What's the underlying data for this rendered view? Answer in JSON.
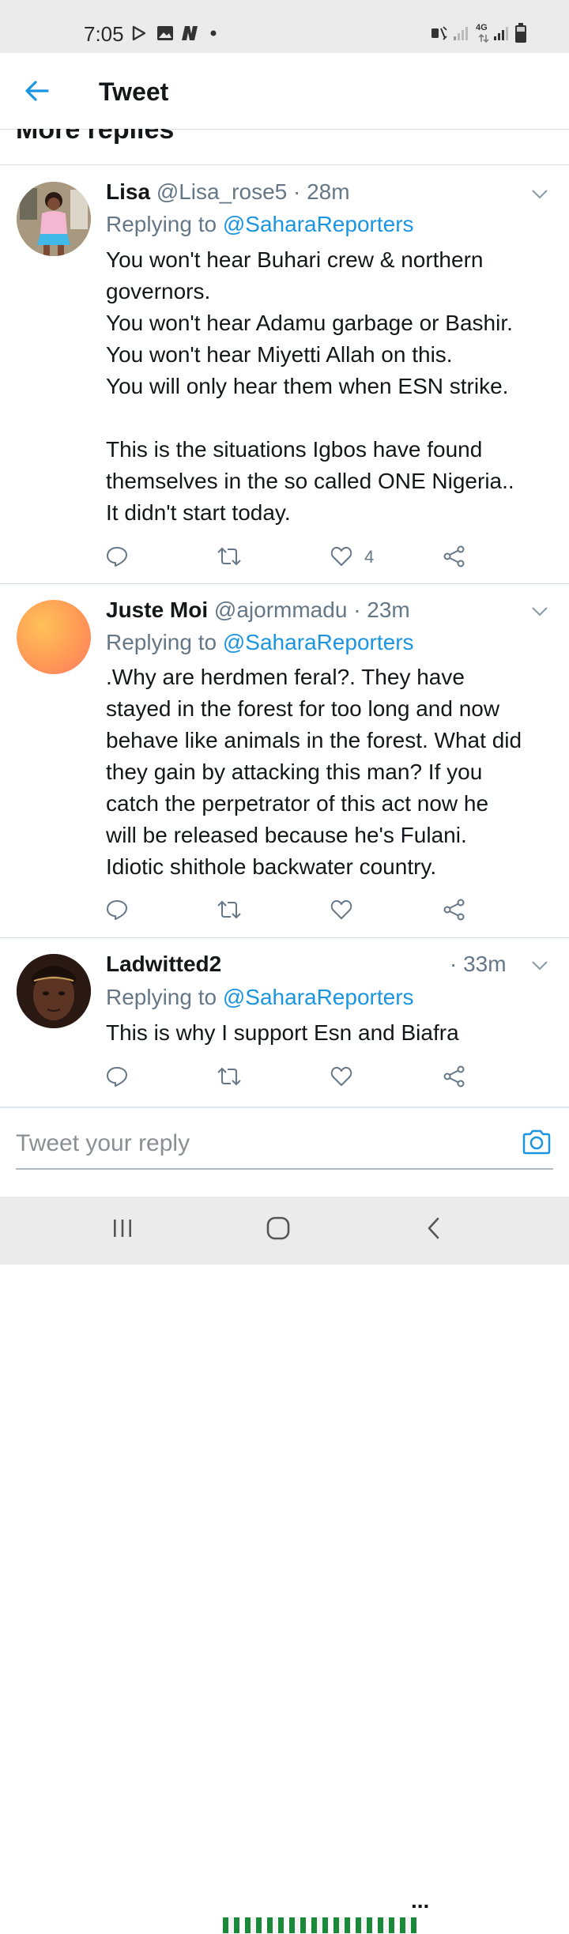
{
  "status_bar": {
    "time": "7:05",
    "icons_left": [
      "play-store-icon",
      "gallery-icon",
      "news-icon",
      "dot-icon"
    ],
    "icons_right": [
      "mute-icon",
      "signal-weak-icon",
      "4g-icon",
      "signal-icon",
      "battery-icon"
    ],
    "network": "4G"
  },
  "app_bar": {
    "title": "Tweet",
    "back_icon": "back-arrow-icon"
  },
  "section": {
    "title": "More replies"
  },
  "tweets": [
    {
      "name": "Lisa",
      "handle": "@Lisa_rose5",
      "time": "· 28m",
      "replying_prefix": "Replying to ",
      "replying_to": "@SaharaReporters",
      "text": "You won't hear Buhari crew & northern\ngovernors.\nYou won't hear Adamu garbage or Bashir.\nYou won't hear Miyetti Allah on this.\nYou will only hear them when ESN strike.\n\nThis is the situations Igbos have found\nthemselves in the so called ONE Nigeria..\nIt didn't start today.",
      "likes": "4"
    },
    {
      "name": "Juste Moi",
      "handle": "@ajormmadu",
      "time": "· 23m",
      "replying_prefix": "Replying to ",
      "replying_to": "@SaharaReporters",
      "text": ".Why are herdmen feral?. They have\nstayed in the forest for too long and now\nbehave like animals in the forest. What did\nthey gain by attacking this man? If you\ncatch the perpetrator of this act now he\nwill be released because he's Fulani.\nIdiotic shithole backwater country.",
      "likes": ""
    },
    {
      "name": "Ladwitted2",
      "name_suffix": "...",
      "handle": "",
      "time": "· 33m",
      "replying_prefix": "Replying to ",
      "replying_to": "@SaharaReporters",
      "text": "This is why I support Esn and Biafra",
      "likes": ""
    }
  ],
  "composer": {
    "placeholder": "Tweet your reply",
    "camera_icon": "camera-icon"
  },
  "nav_bar": {
    "buttons": [
      "recents-icon",
      "home-icon",
      "back-icon"
    ]
  },
  "colors": {
    "link": "#1b95e0",
    "muted": "#657786",
    "text": "#14171a",
    "divider": "#d8dde1"
  }
}
